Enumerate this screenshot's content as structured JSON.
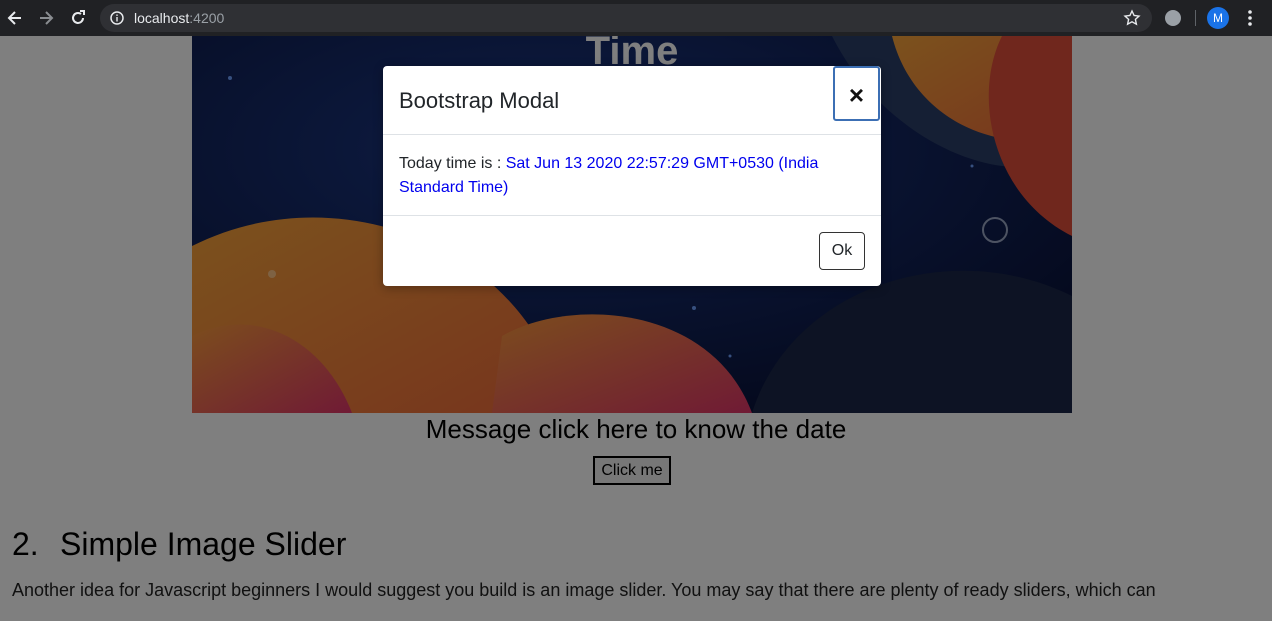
{
  "browser": {
    "url_host": "localhost",
    "url_port": ":4200",
    "profile_initial": "M"
  },
  "hero": {
    "partial_title": "Time"
  },
  "page": {
    "message": "Message click here to know the date",
    "click_button_label": "Click me",
    "section_number": "2.",
    "section_title": "Simple Image Slider",
    "section_paragraph": "Another idea for Javascript beginners I would suggest you build is an image slider. You may say that there are plenty of ready sliders, which can"
  },
  "modal": {
    "title": "Bootstrap Modal",
    "close_label": "×",
    "body_prefix": "Today time is : ",
    "body_time": "Sat Jun 13 2020 22:57:29 GMT+0530 (India Standard Time)",
    "ok_label": "Ok"
  },
  "colors": {
    "chrome_bg": "#202124",
    "modal_time_link": "#0000ee",
    "close_focus_border": "#3c6fb4"
  }
}
